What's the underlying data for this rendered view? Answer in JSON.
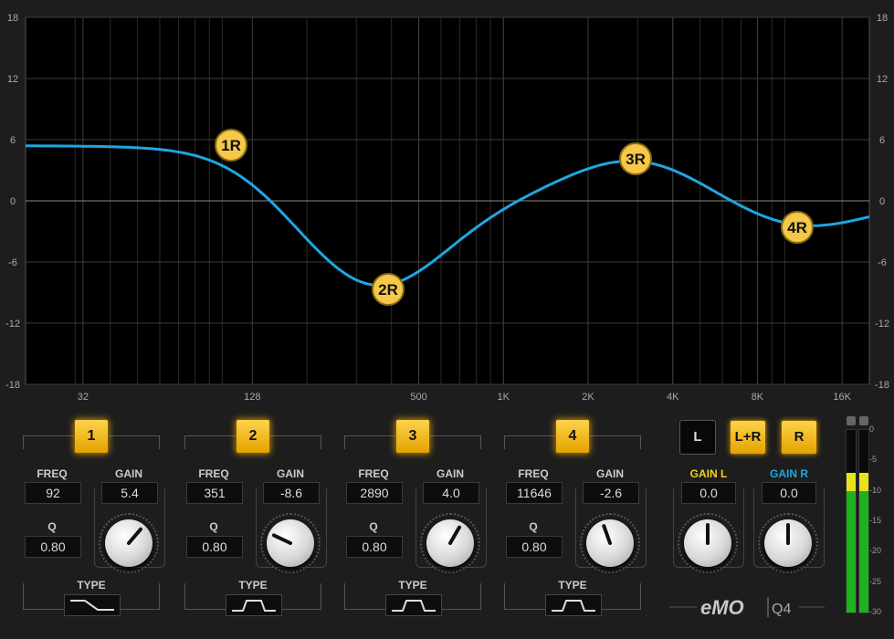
{
  "graph": {
    "y_ticks": [
      "18",
      "12",
      "6",
      "0",
      "-6",
      "-12",
      "-18"
    ],
    "x_ticks": [
      "32",
      "128",
      "500",
      "1K",
      "2K",
      "4K",
      "8K",
      "16K"
    ],
    "curve_color": "#1ea7e1",
    "nodes": [
      {
        "label": "1R",
        "freq": 92,
        "gain": 5.4
      },
      {
        "label": "2R",
        "freq": 351,
        "gain": -8.6
      },
      {
        "label": "3R",
        "freq": 2890,
        "gain": 4.0
      },
      {
        "label": "4R",
        "freq": 11646,
        "gain": -2.6
      }
    ]
  },
  "bands": [
    {
      "number": "1",
      "freq_label": "FREQ",
      "freq": "92",
      "gain_label": "GAIN",
      "gain": "5.4",
      "q_label": "Q",
      "q": "0.80",
      "type_label": "TYPE",
      "type_icon": "low-shelf-icon",
      "knob_level": 5.4
    },
    {
      "number": "2",
      "freq_label": "FREQ",
      "freq": "351",
      "gain_label": "GAIN",
      "gain": "-8.6",
      "q_label": "Q",
      "q": "0.80",
      "type_label": "TYPE",
      "type_icon": "bell-icon",
      "knob_level": -8.6
    },
    {
      "number": "3",
      "freq_label": "FREQ",
      "freq": "2890",
      "gain_label": "GAIN",
      "gain": "4.0",
      "q_label": "Q",
      "q": "0.80",
      "type_label": "TYPE",
      "type_icon": "bell-icon",
      "knob_level": 4.0
    },
    {
      "number": "4",
      "freq_label": "FREQ",
      "freq": "11646",
      "gain_label": "GAIN",
      "gain": "-2.6",
      "q_label": "Q",
      "q": "0.80",
      "type_label": "TYPE",
      "type_icon": "bell-icon",
      "knob_level": -2.6
    }
  ],
  "channel": {
    "l_label": "L",
    "lr_label": "L+R",
    "r_label": "R",
    "gain_l_label": "GAIN L",
    "gain_l": "0.0",
    "gain_r_label": "GAIN R",
    "gain_r": "0.0",
    "gain_l_color": "#f2d21b",
    "gain_r_color": "#1ea7e1"
  },
  "meter": {
    "scale": [
      "0",
      "-5",
      "-10",
      "-15",
      "-20",
      "-25",
      "-30"
    ],
    "left_level_db": -7,
    "right_level_db": -7
  },
  "logo": {
    "brand": "eMO",
    "model": "Q4"
  }
}
